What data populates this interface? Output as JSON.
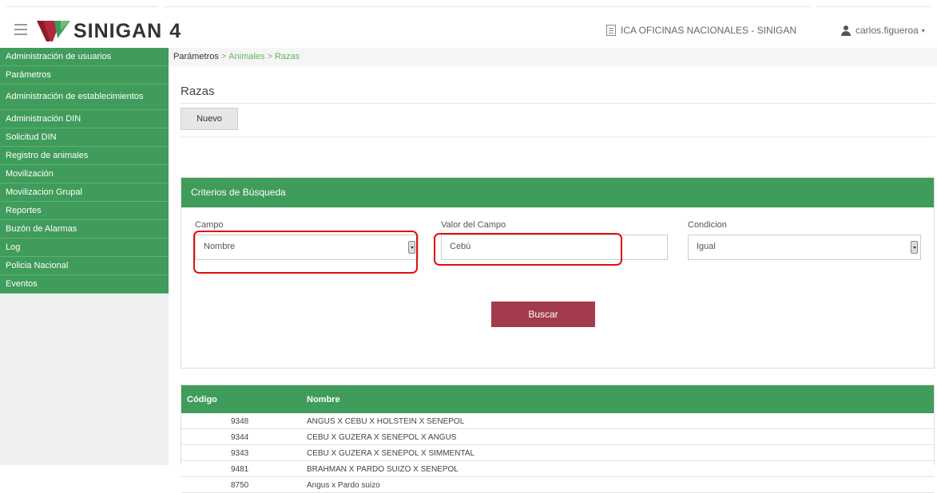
{
  "header": {
    "logo_text": "SINIGAN",
    "logo_version": "4",
    "office": "ICA OFICINAS NACIONALES - SINIGAN",
    "user": "carlos.figueroa",
    "colors": {
      "green": "#3f9c5a",
      "maroon": "#a23b4b"
    }
  },
  "sidebar": {
    "items": [
      {
        "label": "Administración de usuarios"
      },
      {
        "label": "Parámetros"
      },
      {
        "label": "Administración de establecimientos"
      },
      {
        "label": "Administración DIN"
      },
      {
        "label": "Solicitud DIN"
      },
      {
        "label": "Registro de animales"
      },
      {
        "label": "Movilización"
      },
      {
        "label": "Movilizacion Grupal"
      },
      {
        "label": "Reportes"
      },
      {
        "label": "Buzón de Alarmas"
      },
      {
        "label": "Log"
      },
      {
        "label": "Policia Nacional"
      },
      {
        "label": "Eventos"
      }
    ]
  },
  "breadcrumb": {
    "root": "Parámetros",
    "sep": ">",
    "level2": "Animales",
    "level3": "Razas"
  },
  "page": {
    "title": "Razas",
    "new_button": "Nuevo"
  },
  "search": {
    "panel_title": "Criterios de Búsqueda",
    "campo_label": "Campo",
    "campo_value": "Nombre",
    "valor_label": "Valor del Campo",
    "valor_value": "Cebú",
    "condicion_label": "Condicion",
    "condicion_value": "Igual",
    "search_button": "Buscar"
  },
  "table": {
    "columns": [
      "Código",
      "Nombre"
    ],
    "rows": [
      {
        "codigo": "9348",
        "nombre": "ANGUS X CEBU X HOLSTEIN X SENEPOL"
      },
      {
        "codigo": "9344",
        "nombre": "CEBU X GUZERA X SENEPOL X ANGUS"
      },
      {
        "codigo": "9343",
        "nombre": "CEBU X GUZERA X SENEPOL X SIMMENTAL"
      },
      {
        "codigo": "9481",
        "nombre": "BRAHMAN X PARDO SUIZO X SENEPOL"
      },
      {
        "codigo": "8750",
        "nombre": "Angus x Pardo suizo"
      }
    ]
  }
}
